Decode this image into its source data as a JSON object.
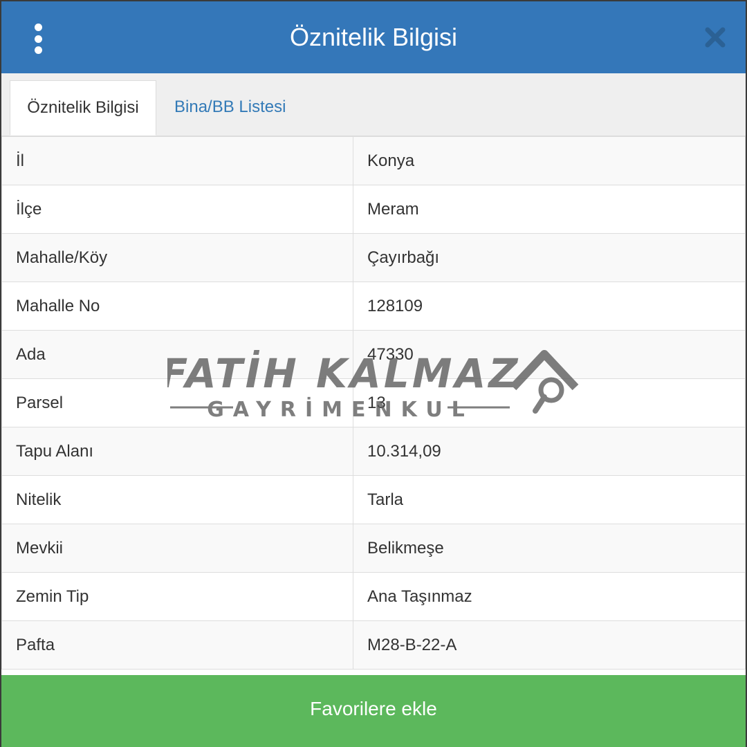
{
  "dialog": {
    "title": "Öznitelik Bilgisi"
  },
  "tabs": [
    {
      "label": "Öznitelik Bilgisi",
      "active": true
    },
    {
      "label": "Bina/BB Listesi",
      "active": false
    }
  ],
  "attributes": [
    {
      "key": "İl",
      "value": "Konya"
    },
    {
      "key": "İlçe",
      "value": "Meram"
    },
    {
      "key": "Mahalle/Köy",
      "value": "Çayırbağı"
    },
    {
      "key": "Mahalle No",
      "value": "128109"
    },
    {
      "key": "Ada",
      "value": "47330"
    },
    {
      "key": "Parsel",
      "value": "13"
    },
    {
      "key": "Tapu Alanı",
      "value": "10.314,09"
    },
    {
      "key": "Nitelik",
      "value": "Tarla"
    },
    {
      "key": "Mevkii",
      "value": "Belikmeşe"
    },
    {
      "key": "Zemin Tip",
      "value": "Ana Taşınmaz"
    },
    {
      "key": "Pafta",
      "value": "M28-B-22-A"
    }
  ],
  "footer": {
    "add_favorites_label": "Favorilere ekle"
  },
  "watermark": {
    "line1": "FATİH KALMAZ",
    "line2": "GAYRİMENKUL"
  },
  "icons": {
    "menu": "vertical-dots-icon",
    "close": "close-x-icon",
    "watermark_logo": "house-search-icon"
  },
  "colors": {
    "header": "#3477b9",
    "link": "#337ab7",
    "footer_button": "#5cb85c",
    "row_stripe": "#f9f9f9"
  }
}
